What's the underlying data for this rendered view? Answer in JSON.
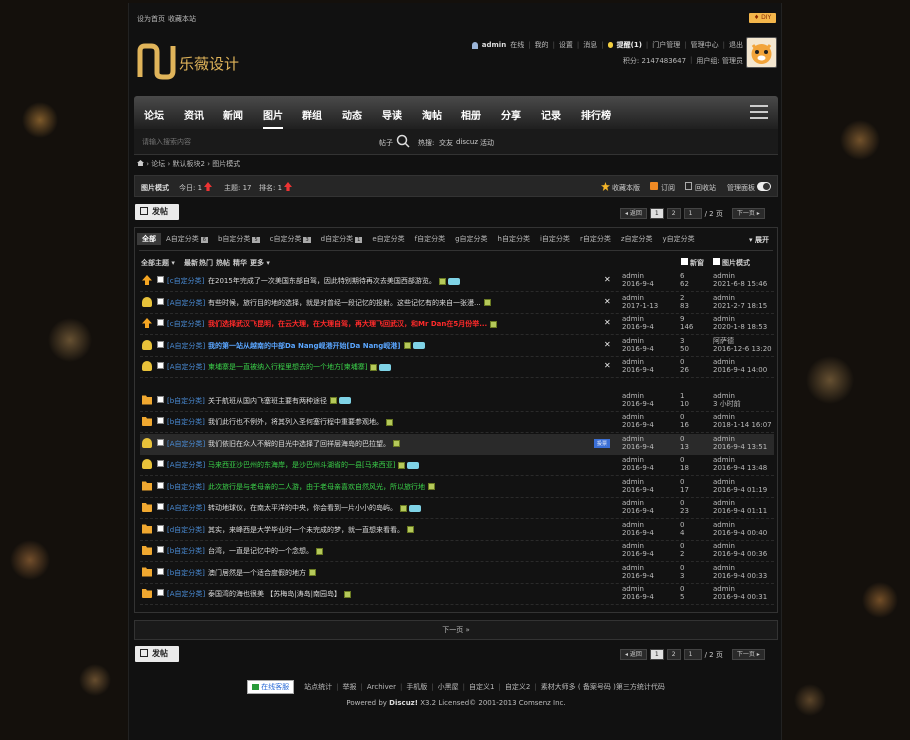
{
  "topbar": {
    "set_home": "设为首页",
    "bookmark": "收藏本站",
    "diy": "♦ DIY"
  },
  "logo": {
    "mark": "N",
    "text": "乐薇设计"
  },
  "user": {
    "name": "admin",
    "online": "在线",
    "my": "我的",
    "settings": "设置",
    "messages": "消息",
    "reminders": "提醒(1)",
    "portal_manage": "门户管理",
    "admin_center": "管理中心",
    "logout": "退出",
    "points": "积分: 2147483647",
    "group": "用户组: 管理员"
  },
  "nav": {
    "items": [
      "论坛",
      "资讯",
      "新闻",
      "图片",
      "群组",
      "动态",
      "导读",
      "淘帖",
      "相册",
      "分享",
      "记录",
      "排行榜"
    ],
    "active": 3
  },
  "search": {
    "placeholder": "请输入搜索内容",
    "type": "帖子",
    "hot_label": "热搜:",
    "hot": [
      "交友",
      "discuz",
      "活动"
    ]
  },
  "breadcrumb": [
    "论坛",
    "默认板块2",
    "图片模式"
  ],
  "forumbar": {
    "mode": "图片模式",
    "today": "今日: 1",
    "topics": "主题: 17",
    "rank": "排名: 1",
    "fav": "收藏本版",
    "subscribe": "订阅",
    "recycle": "回收站",
    "panel": "管理面板"
  },
  "post_button": "发帖",
  "pager": {
    "back": "◂ 返回",
    "pages": [
      "1",
      "2"
    ],
    "input": "1",
    "total": "/ 2 页",
    "next": "下一页 ▸"
  },
  "categories": [
    {
      "label": "全部"
    },
    {
      "label": "A自定分类",
      "count": "6"
    },
    {
      "label": "b自定分类",
      "count": "5"
    },
    {
      "label": "c自定分类",
      "count": "3"
    },
    {
      "label": "d自定分类",
      "count": "1"
    },
    {
      "label": "e自定分类"
    },
    {
      "label": "f自定分类"
    },
    {
      "label": "g自定分类"
    },
    {
      "label": "h自定分类"
    },
    {
      "label": "i自定分类"
    },
    {
      "label": "r自定分类"
    },
    {
      "label": "z自定分类"
    },
    {
      "label": "y自定分类"
    }
  ],
  "expand": "▾ 展开",
  "filters": {
    "all": "全部主题 ▾",
    "latest": "最新",
    "hot": "热门",
    "heat": "热帖",
    "digest": "精华",
    "more": "更多 ▾",
    "new": "新窗",
    "img_mode": "图片模式"
  },
  "threads": [
    {
      "icon": "up",
      "cat": "[c自定分类]",
      "title": "在2015年完成了一次美国东部自驾，因此特别期待再次去美国西部游览。",
      "style": "",
      "img": true,
      "new": true,
      "x": true,
      "author": "admin",
      "date": "2016-9-4",
      "replies": "6",
      "views": "62",
      "last_user": "admin",
      "last_date": "2021-6-8 15:46"
    },
    {
      "icon": "people",
      "cat": "[A自定分类]",
      "title": "有些时候，旅行目的地的选择，就是对曾经一段记忆的投射。这些记忆有的来自一张漫...",
      "style": "",
      "img": true,
      "new": false,
      "x": true,
      "author": "admin",
      "date": "2017-1-13",
      "replies": "2",
      "views": "83",
      "last_user": "admin",
      "last_date": "2021-2-7 18:15"
    },
    {
      "icon": "up",
      "cat": "[c自定分类]",
      "title": "我们选择武汉飞昆明，在云大理，在大理自驾，再大理飞回武汉，和Mr Dan在5月份举...",
      "style": "red",
      "img": true,
      "new": false,
      "x": true,
      "author": "admin",
      "date": "2016-9-4",
      "replies": "9",
      "views": "146",
      "last_user": "admin",
      "last_date": "2020-1-8 18:53"
    },
    {
      "icon": "people",
      "cat": "[A自定分类]",
      "title": "我的第一站从越南的中部Da Nang岘港开始[Da Nang岘港]",
      "style": "blue",
      "img": true,
      "new": true,
      "x": true,
      "author": "admin",
      "date": "2016-9-4",
      "replies": "3",
      "views": "50",
      "last_user": "阿萨德",
      "last_date": "2016-12-6 13:20"
    },
    {
      "icon": "people",
      "cat": "[A自定分类]",
      "title": "柬埔寨是一直被纳入行程里想去的一个地方[柬埔寨]",
      "style": "green",
      "img": true,
      "new": true,
      "x": true,
      "author": "admin",
      "date": "2016-9-4",
      "replies": "0",
      "views": "26",
      "last_user": "admin",
      "last_date": "2016-9-4 14:00"
    },
    {
      "icon": "folder",
      "cat": "[b自定分类]",
      "title": "关于航班从国内飞塞班主要有两种途径",
      "style": "",
      "img": true,
      "new": true,
      "x": false,
      "author": "admin",
      "date": "2016-9-4",
      "replies": "1",
      "views": "10",
      "last_user": "admin",
      "last_date": "3 小时前"
    },
    {
      "icon": "folder",
      "cat": "[b自定分类]",
      "title": "我们此行也不例外，将其列入圣何塞行程中重要参观地。",
      "style": "",
      "img": true,
      "new": false,
      "x": false,
      "author": "admin",
      "date": "2016-9-4",
      "replies": "0",
      "views": "16",
      "last_user": "admin",
      "last_date": "2018-1-14 16:07"
    },
    {
      "icon": "people",
      "cat": "[A自定分类]",
      "title": "我们依旧在众人不解的目光中选择了回祥层海岛的巴拉望。",
      "style": "",
      "img": true,
      "new": false,
      "x": false,
      "tag": "投票",
      "highlight": true,
      "author": "admin",
      "date": "2016-9-4",
      "replies": "0",
      "views": "13",
      "last_user": "admin",
      "last_date": "2016-9-4 13:51"
    },
    {
      "icon": "people",
      "cat": "[A自定分类]",
      "title": "马来西亚沙巴州的东海岸，是沙巴州斗湖省的一县[马来西亚]",
      "style": "green",
      "img": true,
      "new": true,
      "x": false,
      "author": "admin",
      "date": "2016-9-4",
      "replies": "0",
      "views": "18",
      "last_user": "admin",
      "last_date": "2016-9-4 13:48"
    },
    {
      "icon": "folder",
      "cat": "[b自定分类]",
      "title": "此次旅行是与老母亲的二人游，由于老母亲喜欢自然风光，所以旅行地",
      "style": "green",
      "img": true,
      "new": false,
      "x": false,
      "author": "admin",
      "date": "2016-9-4",
      "replies": "0",
      "views": "17",
      "last_user": "admin",
      "last_date": "2016-9-4 01:19"
    },
    {
      "icon": "folder",
      "cat": "[A自定分类]",
      "title": "转动地球仪，在南太平洋的中央，你会看到一片小小的岛屿。",
      "style": "",
      "img": true,
      "new": true,
      "x": false,
      "author": "admin",
      "date": "2016-9-4",
      "replies": "0",
      "views": "23",
      "last_user": "admin",
      "last_date": "2016-9-4 01:11"
    },
    {
      "icon": "folder",
      "cat": "[d自定分类]",
      "title": "其实，来峰西是大学毕业时一个未完成的梦，就一直想来看看。",
      "style": "",
      "img": true,
      "new": false,
      "x": false,
      "author": "admin",
      "date": "2016-9-4",
      "replies": "0",
      "views": "4",
      "last_user": "admin",
      "last_date": "2016-9-4 00:40"
    },
    {
      "icon": "folder",
      "cat": "[b自定分类]",
      "title": "台湾，一直是记忆中的一个念想。",
      "style": "",
      "img": true,
      "new": false,
      "x": false,
      "author": "admin",
      "date": "2016-9-4",
      "replies": "0",
      "views": "2",
      "last_user": "admin",
      "last_date": "2016-9-4 00:36"
    },
    {
      "icon": "folder",
      "cat": "[b自定分类]",
      "title": "澳门居然是一个适合度假的地方",
      "style": "",
      "img": true,
      "new": false,
      "x": false,
      "author": "admin",
      "date": "2016-9-4",
      "replies": "0",
      "views": "3",
      "last_user": "admin",
      "last_date": "2016-9-4 00:33"
    },
    {
      "icon": "folder",
      "cat": "[A自定分类]",
      "title": "泰国湾的海也很美 【苏梅岛|涛岛|南园岛】",
      "style": "",
      "img": true,
      "new": false,
      "x": false,
      "author": "admin",
      "date": "2016-9-4",
      "replies": "0",
      "views": "5",
      "last_user": "admin",
      "last_date": "2016-9-4 00:31"
    }
  ],
  "next_page": "下一页 »",
  "footer": {
    "service": "在线客服",
    "links": [
      "站点统计",
      "举报",
      "Archiver",
      "手机版",
      "小黑屋",
      "自定义1",
      "自定义2",
      "素材大师多 ( 备案号码 )第三方统计代码"
    ],
    "powered": "Powered by",
    "brand": "Discuz!",
    "version": "X3.2 Licensed© 2001-2013 Comsenz Inc."
  }
}
